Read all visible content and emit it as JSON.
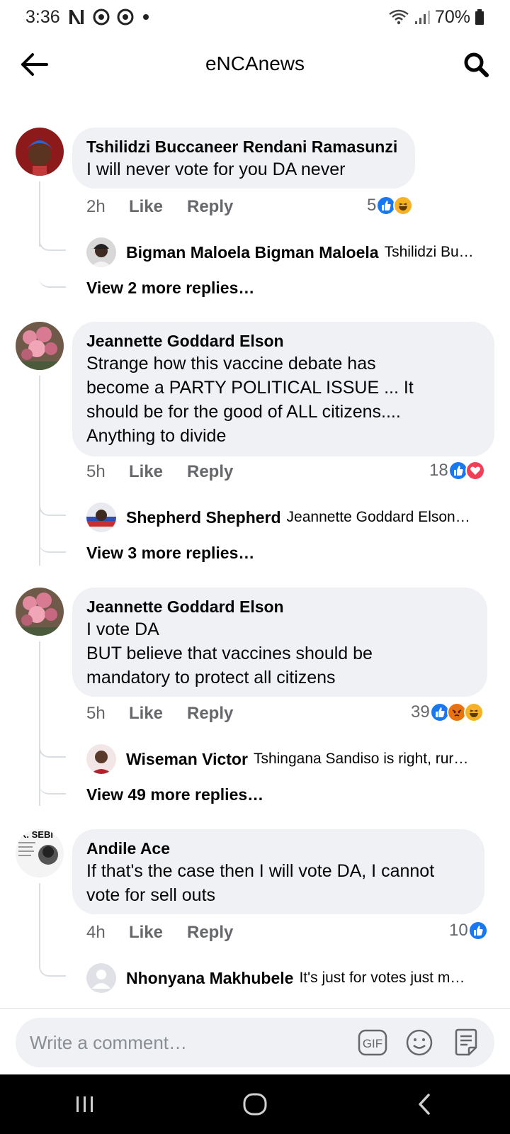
{
  "status_bar": {
    "time": "3:36",
    "battery": "70%",
    "icons": [
      "netflix-icon",
      "chrome-icon",
      "chrome-icon",
      "dot-icon",
      "wifi-icon",
      "signal-icon",
      "battery-icon"
    ]
  },
  "header": {
    "title": "eNCAnews",
    "back_icon": "back-arrow-icon",
    "search_icon": "search-icon"
  },
  "comments": [
    {
      "author": "Tshilidzi Buccaneer Rendani Ramasunzi",
      "text": "I will never vote for you DA never",
      "time": "2h",
      "like_label": "Like",
      "reply_label": "Reply",
      "reaction_count": "5",
      "reactions": [
        "like",
        "haha"
      ],
      "reply_preview": {
        "author": "Bigman Maloela Bigman Maloela",
        "text": "Tshilidzi Bu…"
      },
      "more_replies": "View 2 more replies…"
    },
    {
      "author": "Jeannette Goddard Elson",
      "text": "Strange how this vaccine debate has\nbecome a PARTY POLITICAL ISSUE ... It\nshould be for the good of ALL citizens....\nAnything to divide",
      "time": "5h",
      "like_label": "Like",
      "reply_label": "Reply",
      "reaction_count": "18",
      "reactions": [
        "like",
        "love"
      ],
      "reply_preview": {
        "author": "Shepherd Shepherd",
        "text": "Jeannette Goddard Elson…"
      },
      "more_replies": "View 3 more replies…"
    },
    {
      "author": "Jeannette Goddard Elson",
      "text": "I vote DA\nBUT believe  that vaccines should be\nmandatory to protect all citizens",
      "time": "5h",
      "like_label": "Like",
      "reply_label": "Reply",
      "reaction_count": "39",
      "reactions": [
        "like",
        "angry",
        "haha"
      ],
      "reply_preview": {
        "author": "Wiseman Victor",
        "text": "Tshingana Sandiso is right, rur…"
      },
      "more_replies": "View 49 more replies…"
    },
    {
      "author": "Andile Ace",
      "text": "If that's the case then I will vote DA, I cannot\nvote for sell outs",
      "time": "4h",
      "like_label": "Like",
      "reply_label": "Reply",
      "reaction_count": "10",
      "reactions": [
        "like"
      ],
      "avatar_text": "K. SEBI",
      "reply_preview": {
        "author": "Nhonyana Makhubele",
        "text": "It's just for votes just  m…"
      }
    }
  ],
  "composer": {
    "placeholder": "Write a comment…",
    "icons": [
      "gif-icon",
      "emoji-icon",
      "sticker-icon"
    ]
  },
  "nav": {
    "icons": [
      "recents-icon",
      "home-icon",
      "back-icon"
    ]
  },
  "colors": {
    "bubble": "#eff1f5",
    "like_blue": "#1877f2",
    "love_red": "#f33e58",
    "haha_yellow": "#f7b125",
    "angry_orange": "#e9710f",
    "secondary_text": "#65676b"
  }
}
